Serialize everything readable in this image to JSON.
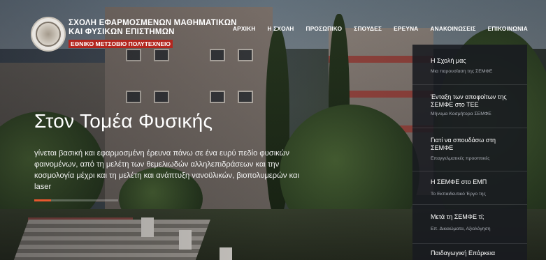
{
  "header": {
    "school_line1": "ΣΧΟΛΗ ΕΦΑΡΜΟΣΜΕΝΩΝ ΜΑΘΗΜΑΤΙΚΩΝ",
    "school_line2": "ΚΑΙ ΦΥΣΙΚΩΝ ΕΠΙΣΤΗΜΩΝ",
    "university": "ΕΘΝΙΚΟ ΜΕΤΣΟΒΙΟ ΠΟΛΥΤΕΧΝΕΙΟ",
    "logo_icon": "university-seal-icon"
  },
  "nav": {
    "items": [
      "ΑΡΧΙΚΗ",
      "Η ΣΧΟΛΗ",
      "ΠΡΟΣΩΠΙΚΟ",
      "ΣΠΟΥΔΕΣ",
      "ΕΡΕΥΝΑ",
      "ΑΝΑΚΟΙΝΩΣΕΙΣ",
      "ΕΠΙΚΟΙΝΩΝΙΑ"
    ]
  },
  "hero": {
    "title": "Στον Τομέα Φυσικής",
    "description": "γίνεται βασική και εφαρμοσμένη έρευνα πάνω σε ένα ευρύ πεδίο φυσικών φαινομένων, από τη μελέτη των θεμελιωδών αλληλεπιδράσεων και την κοσμολογία μέχρι και τη μελέτη και ανάπτυξη νανοϋλικών, βιοπολυμερών και laser",
    "accent_color": "#e8582f"
  },
  "sidebar": {
    "items": [
      {
        "title": "Η Σχολή μας",
        "subtitle": "Μια παρουσίαση της ΣΕΜΦΕ"
      },
      {
        "title": "Ένταξη των αποφοίτων της ΣΕΜΦΕ στο ΤΕΕ",
        "subtitle": "Μήνυμα Κοσμήτορα ΣΕΜΦΕ"
      },
      {
        "title": "Γιατί να σπουδάσω στη ΣΕΜΦΕ",
        "subtitle": "Επαγγελματικές προοπτικές"
      },
      {
        "title": "Η ΣΕΜΦΕ στο ΕΜΠ",
        "subtitle": "Το Εκπαιδευτικό Έργο της"
      },
      {
        "title": "Μετά τη ΣΕΜΦΕ τί;",
        "subtitle": "Επ. Δικαιώματα, Αξιολόγηση"
      },
      {
        "title": "Παιδαγωγική Επάρκεια",
        "subtitle": ""
      }
    ]
  }
}
